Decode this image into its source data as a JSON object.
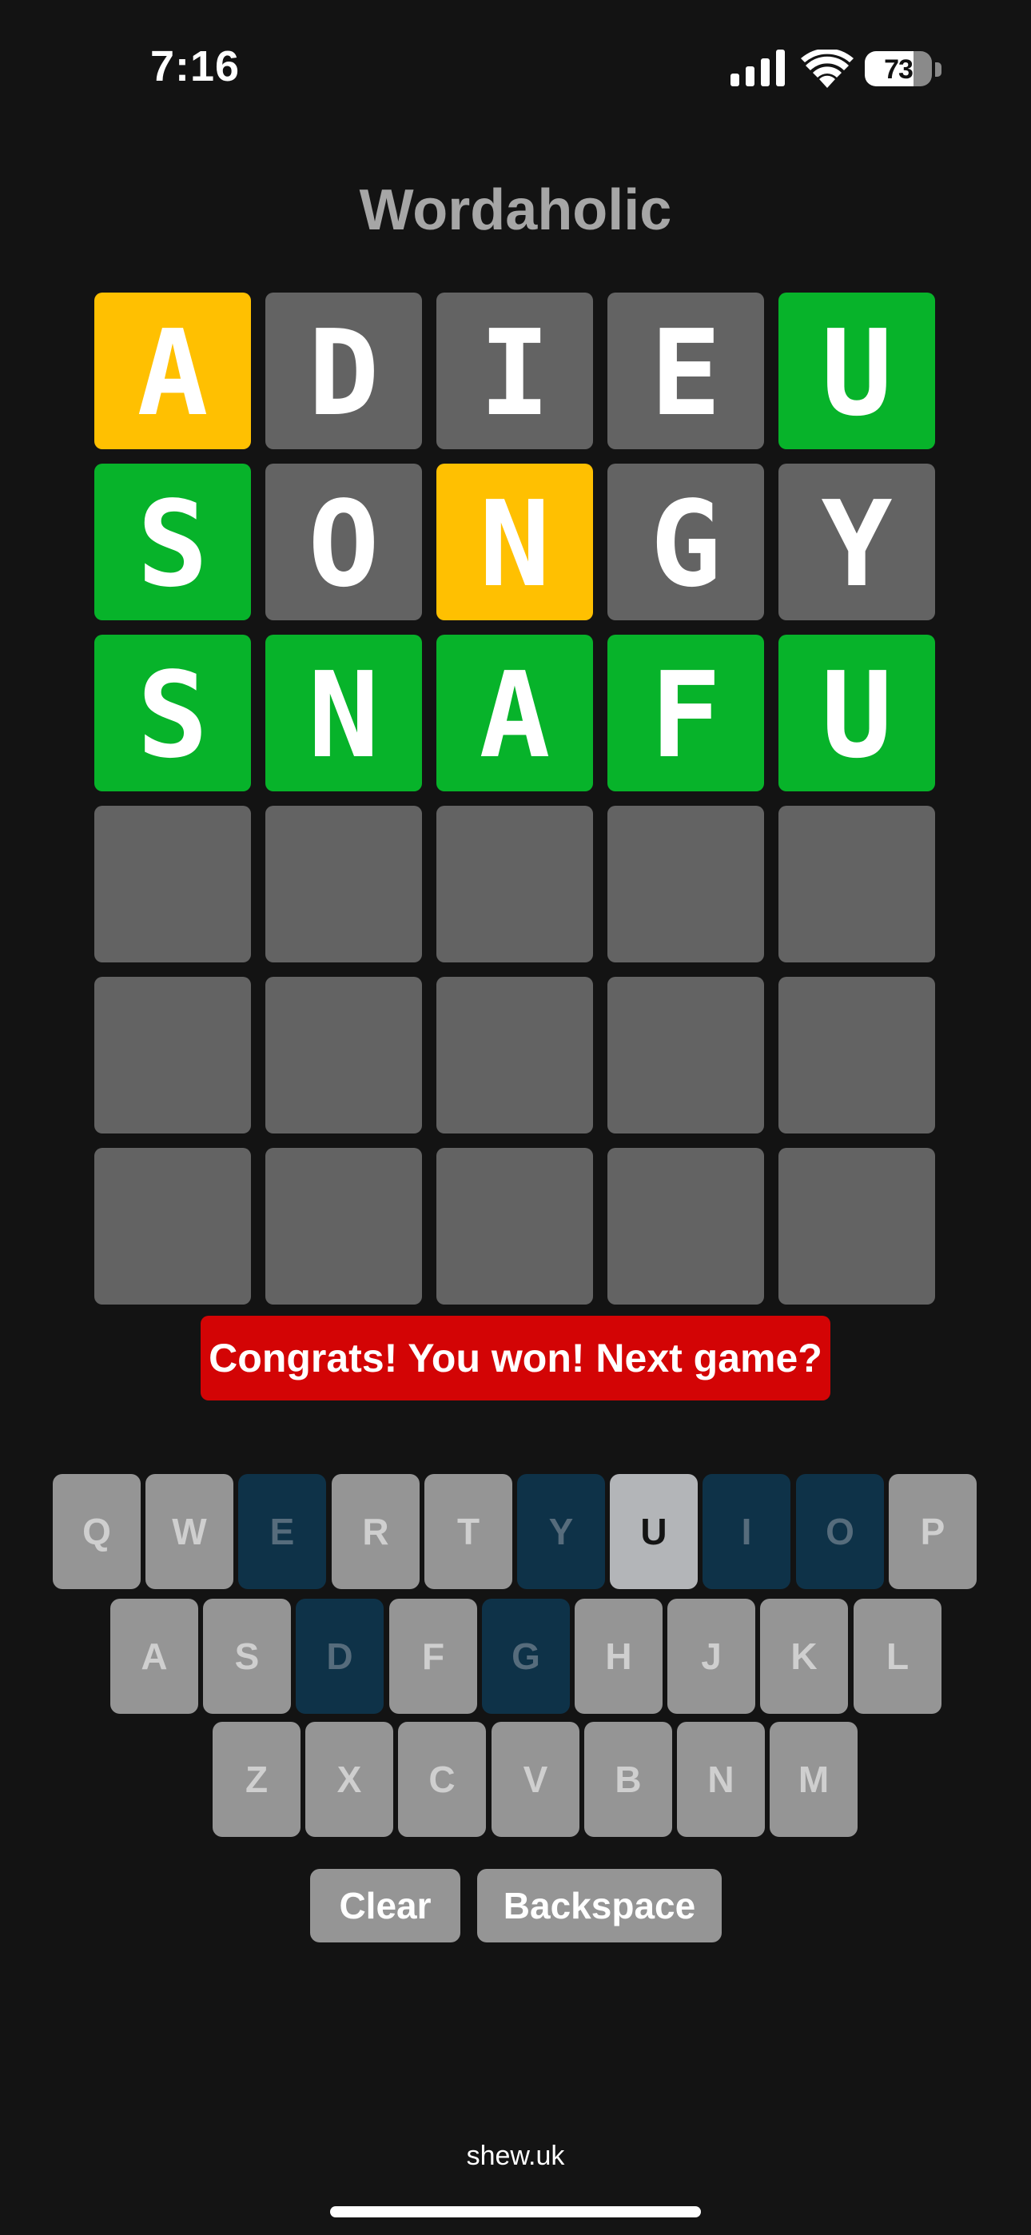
{
  "status_bar": {
    "time": "7:16",
    "battery": "73",
    "battery_level": 0.73
  },
  "app": {
    "title": "Wordaholic"
  },
  "board": {
    "rows": [
      [
        {
          "letter": "A",
          "state": "present"
        },
        {
          "letter": "D",
          "state": "absent"
        },
        {
          "letter": "I",
          "state": "absent"
        },
        {
          "letter": "E",
          "state": "absent"
        },
        {
          "letter": "U",
          "state": "correct"
        }
      ],
      [
        {
          "letter": "S",
          "state": "correct"
        },
        {
          "letter": "O",
          "state": "absent"
        },
        {
          "letter": "N",
          "state": "present"
        },
        {
          "letter": "G",
          "state": "absent"
        },
        {
          "letter": "Y",
          "state": "absent"
        }
      ],
      [
        {
          "letter": "S",
          "state": "correct"
        },
        {
          "letter": "N",
          "state": "correct"
        },
        {
          "letter": "A",
          "state": "correct"
        },
        {
          "letter": "F",
          "state": "correct"
        },
        {
          "letter": "U",
          "state": "correct"
        }
      ],
      [
        {
          "letter": "",
          "state": "empty"
        },
        {
          "letter": "",
          "state": "empty"
        },
        {
          "letter": "",
          "state": "empty"
        },
        {
          "letter": "",
          "state": "empty"
        },
        {
          "letter": "",
          "state": "empty"
        }
      ],
      [
        {
          "letter": "",
          "state": "empty"
        },
        {
          "letter": "",
          "state": "empty"
        },
        {
          "letter": "",
          "state": "empty"
        },
        {
          "letter": "",
          "state": "empty"
        },
        {
          "letter": "",
          "state": "empty"
        }
      ],
      [
        {
          "letter": "",
          "state": "empty"
        },
        {
          "letter": "",
          "state": "empty"
        },
        {
          "letter": "",
          "state": "empty"
        },
        {
          "letter": "",
          "state": "empty"
        },
        {
          "letter": "",
          "state": "empty"
        }
      ]
    ]
  },
  "banner": {
    "text": "Congrats! You won! Next game?"
  },
  "keyboard": {
    "rows": [
      [
        {
          "key": "Q",
          "state": "unused"
        },
        {
          "key": "W",
          "state": "unused"
        },
        {
          "key": "E",
          "state": "absent"
        },
        {
          "key": "R",
          "state": "unused"
        },
        {
          "key": "T",
          "state": "unused"
        },
        {
          "key": "Y",
          "state": "absent"
        },
        {
          "key": "U",
          "state": "used"
        },
        {
          "key": "I",
          "state": "absent"
        },
        {
          "key": "O",
          "state": "absent"
        },
        {
          "key": "P",
          "state": "unused"
        }
      ],
      [
        {
          "key": "A",
          "state": "unused"
        },
        {
          "key": "S",
          "state": "unused"
        },
        {
          "key": "D",
          "state": "absent"
        },
        {
          "key": "F",
          "state": "unused"
        },
        {
          "key": "G",
          "state": "absent"
        },
        {
          "key": "H",
          "state": "unused"
        },
        {
          "key": "J",
          "state": "unused"
        },
        {
          "key": "K",
          "state": "unused"
        },
        {
          "key": "L",
          "state": "unused"
        }
      ],
      [
        {
          "key": "Z",
          "state": "unused"
        },
        {
          "key": "X",
          "state": "unused"
        },
        {
          "key": "C",
          "state": "unused"
        },
        {
          "key": "V",
          "state": "unused"
        },
        {
          "key": "B",
          "state": "unused"
        },
        {
          "key": "N",
          "state": "unused"
        },
        {
          "key": "M",
          "state": "unused"
        }
      ]
    ],
    "clear_label": "Clear",
    "backspace_label": "Backspace"
  },
  "browser": {
    "url": "shew.uk"
  },
  "colors": {
    "background": "#131313",
    "tile_empty": "#636363",
    "tile_present": "#ffc001",
    "tile_correct": "#07b32a",
    "banner": "#d30405",
    "key_default": "#959595",
    "key_absent": "#0e3248",
    "key_used": "#b3b5b8"
  }
}
